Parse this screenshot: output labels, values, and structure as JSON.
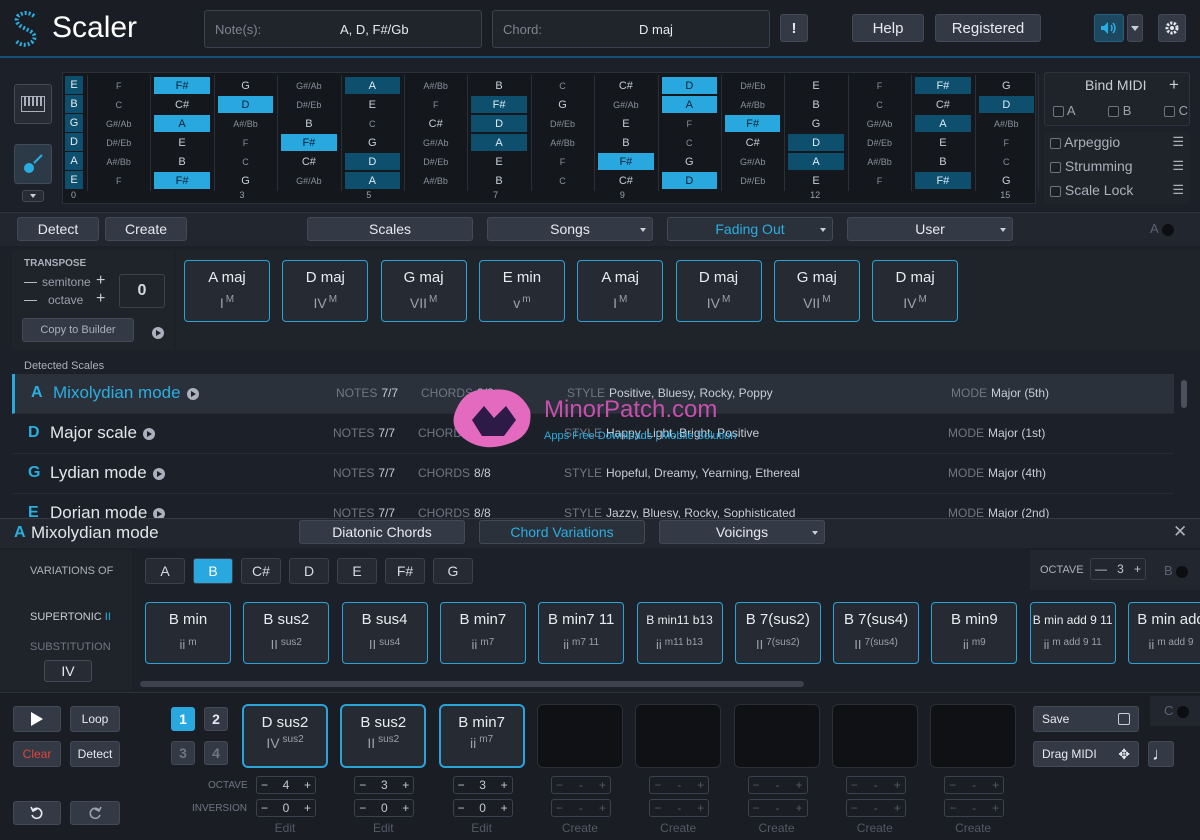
{
  "header": {
    "app_name": "Scaler",
    "notes_label": "Note(s):",
    "notes_value": "A, D, F#/Gb",
    "chord_label": "Chord:",
    "chord_value": "D maj",
    "alert": "!",
    "help": "Help",
    "registered": "Registered"
  },
  "fretboard": {
    "strings": [
      "E",
      "B",
      "G",
      "D",
      "A",
      "E"
    ],
    "rows": [
      [
        "F",
        "F#",
        "G",
        "G#/Ab",
        "A",
        "A#/Bb",
        "B",
        "C",
        "C#",
        "D",
        "D#/Eb",
        "E",
        "F",
        "F#",
        "G"
      ],
      [
        "C",
        "C#",
        "D",
        "D#/Eb",
        "E",
        "F",
        "F#",
        "G",
        "G#/Ab",
        "A",
        "A#/Bb",
        "B",
        "C",
        "C#",
        "D"
      ],
      [
        "G#/Ab",
        "A",
        "A#/Bb",
        "B",
        "C",
        "C#",
        "D",
        "D#/Eb",
        "E",
        "F",
        "F#",
        "G",
        "G#/Ab",
        "A",
        "A#/Bb"
      ],
      [
        "D#/Eb",
        "E",
        "F",
        "F#",
        "G",
        "G#/Ab",
        "A",
        "A#/Bb",
        "B",
        "C",
        "C#",
        "D",
        "D#/Eb",
        "E",
        "F"
      ],
      [
        "A#/Bb",
        "B",
        "C",
        "C#",
        "D",
        "D#/Eb",
        "E",
        "F",
        "F#",
        "G",
        "G#/Ab",
        "A",
        "A#/Bb",
        "B",
        "C"
      ],
      [
        "F",
        "F#",
        "G",
        "G#/Ab",
        "A",
        "A#/Bb",
        "B",
        "C",
        "C#",
        "D",
        "D#/Eb",
        "E",
        "F",
        "F#",
        "G"
      ]
    ],
    "fret_numbers": [
      "0",
      "3",
      "5",
      "7",
      "9",
      "12",
      "15"
    ]
  },
  "side_panel": {
    "bind_midi": "Bind MIDI",
    "plus": "+",
    "slots": [
      "A",
      "B",
      "C"
    ],
    "options": [
      "Arpeggio",
      "Strumming",
      "Scale Lock"
    ]
  },
  "tabs": {
    "detect": "Detect",
    "create": "Create",
    "scales": "Scales",
    "songs": "Songs",
    "fading_out": "Fading Out",
    "user": "User",
    "a_toggle": "A"
  },
  "transpose": {
    "title": "TRANSPOSE",
    "semitone": "semitone",
    "octave": "octave",
    "value": "0",
    "copy": "Copy to Builder",
    "minus": "—",
    "plus": "+"
  },
  "progression": [
    {
      "name": "A maj",
      "numeral": "I",
      "q": "M"
    },
    {
      "name": "D maj",
      "numeral": "IV",
      "q": "M"
    },
    {
      "name": "G maj",
      "numeral": "VII",
      "q": "M"
    },
    {
      "name": "E min",
      "numeral": "v",
      "q": "m"
    },
    {
      "name": "A maj",
      "numeral": "I",
      "q": "M"
    },
    {
      "name": "D maj",
      "numeral": "IV",
      "q": "M"
    },
    {
      "name": "G maj",
      "numeral": "VII",
      "q": "M"
    },
    {
      "name": "D maj",
      "numeral": "IV",
      "q": "M"
    }
  ],
  "detected_scales": {
    "title": "Detected Scales",
    "notes_label": "NOTES",
    "chords_label": "CHORDS",
    "style_label": "STYLE",
    "mode_label": "MODE",
    "items": [
      {
        "key": "A",
        "name": "Mixolydian mode",
        "notes": "7/7",
        "chords": "8/8",
        "style": "Positive, Bluesy, Rocky, Poppy",
        "mode": "Major (5th)"
      },
      {
        "key": "D",
        "name": "Major scale",
        "notes": "7/7",
        "chords": "8/8",
        "style": "Happy, Light, Bright, Positive",
        "mode": "Major (1st)"
      },
      {
        "key": "G",
        "name": "Lydian mode",
        "notes": "7/7",
        "chords": "8/8",
        "style": "Hopeful, Dreamy, Yearning, Ethereal",
        "mode": "Major (4th)"
      },
      {
        "key": "E",
        "name": "Dorian mode",
        "notes": "7/7",
        "chords": "8/8",
        "style": "Jazzy, Bluesy, Rocky, Sophisticated",
        "mode": "Major (2nd)"
      }
    ]
  },
  "watermark": {
    "title": "MinorPatch.com",
    "subtitle": "Apps Free Downloads | Mobile Solution"
  },
  "mode_panel": {
    "key": "A",
    "name": "Mixolydian mode",
    "tab_diatonic": "Diatonic Chords",
    "tab_variations": "Chord Variations",
    "tab_voicings": "Voicings",
    "close": "✕"
  },
  "variations": {
    "label": "VARIATIONS OF",
    "notes": [
      "A",
      "B",
      "C#",
      "D",
      "E",
      "F#",
      "G"
    ],
    "selected": "B",
    "octave_label": "OCTAVE",
    "octave_value": "3",
    "b_toggle": "B",
    "function": "SUPERTONIC",
    "function_numeral": "II",
    "substitution": "SUBSTITUTION",
    "sub_value": "IV",
    "chords": [
      {
        "name": "B min",
        "numeral": "ii",
        "q": "m"
      },
      {
        "name": "B sus2",
        "numeral": "II",
        "q": "sus2"
      },
      {
        "name": "B sus4",
        "numeral": "II",
        "q": "sus4"
      },
      {
        "name": "B min7",
        "numeral": "ii",
        "q": "m7"
      },
      {
        "name": "B min7 11",
        "numeral": "ii",
        "q": "m7 11"
      },
      {
        "name": "B min11 b13",
        "numeral": "ii",
        "q": "m11 b13"
      },
      {
        "name": "B 7(sus2)",
        "numeral": "II",
        "q": "7(sus2)"
      },
      {
        "name": "B 7(sus4)",
        "numeral": "II",
        "q": "7(sus4)"
      },
      {
        "name": "B min9",
        "numeral": "ii",
        "q": "m9"
      },
      {
        "name": "B min add 9 11",
        "numeral": "ii",
        "q": "m add 9 11"
      },
      {
        "name": "B min add",
        "numeral": "ii",
        "q": "m add 9"
      }
    ]
  },
  "bottom": {
    "loop": "Loop",
    "clear": "Clear",
    "detect": "Detect",
    "banks": [
      "1",
      "2",
      "3",
      "4"
    ],
    "octave_label": "OCTAVE",
    "inversion_label": "INVERSION",
    "save": "Save",
    "drag_midi": "Drag MIDI",
    "c_toggle": "C",
    "pads": [
      {
        "name": "D sus2",
        "numeral": "IV",
        "q": "sus2",
        "octave": "4",
        "inversion": "0",
        "action": "Edit"
      },
      {
        "name": "B sus2",
        "numeral": "II",
        "q": "sus2",
        "octave": "3",
        "inversion": "0",
        "action": "Edit"
      },
      {
        "name": "B min7",
        "numeral": "ii",
        "q": "m7",
        "octave": "3",
        "inversion": "0",
        "action": "Edit"
      },
      {
        "name": "",
        "numeral": "",
        "q": "",
        "octave": "-",
        "inversion": "-",
        "action": "Create"
      },
      {
        "name": "",
        "numeral": "",
        "q": "",
        "octave": "-",
        "inversion": "-",
        "action": "Create"
      },
      {
        "name": "",
        "numeral": "",
        "q": "",
        "octave": "-",
        "inversion": "-",
        "action": "Create"
      },
      {
        "name": "",
        "numeral": "",
        "q": "",
        "octave": "-",
        "inversion": "-",
        "action": "Create"
      },
      {
        "name": "",
        "numeral": "",
        "q": "",
        "octave": "-",
        "inversion": "-",
        "action": "Create"
      }
    ]
  },
  "colors": {
    "accent": "#29a8e0",
    "bg": "#1c2028",
    "panel": "#252a33",
    "clear": "#e0443c"
  }
}
